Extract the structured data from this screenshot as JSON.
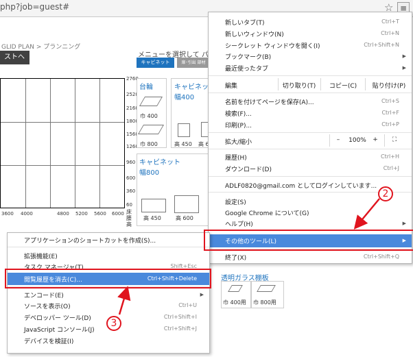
{
  "browser": {
    "url": "php?job=guest#",
    "star_icon": "star-icon",
    "menu_icon": "hamburger-menu-icon"
  },
  "page": {
    "breadcrumb": "GLID PLAN > プランニング",
    "next_button": "ストへ ❯",
    "menu_hint": "メニューを選択して パーツ",
    "btn_cabinet": "キャビネット",
    "btn_drawer": "扉･引出 部材",
    "chart_y_ticks": [
      "2760",
      "2520",
      "2160",
      "1800",
      "1560",
      "1260",
      "960",
      "600",
      "360",
      "60"
    ],
    "chart_x_ticks": [
      "3600",
      "4000",
      "4800",
      "5200",
      "5600",
      "6000"
    ],
    "floor_label": "床腰高",
    "cards": {
      "dai": {
        "title": "台輪",
        "size1": "巾 400",
        "size2": "巾 800"
      },
      "cab_400": {
        "title": "キャビネッ",
        "subtitle": "幅400",
        "size1": "高 450",
        "size2": "高 6"
      },
      "cab_800": {
        "title": "キャビネット",
        "subtitle": "幅800",
        "size1": "高 450",
        "size2": "高 600"
      },
      "glass": {
        "title": "透明ガラス棚板",
        "size1": "巾 400用",
        "size2": "巾 800用"
      }
    }
  },
  "chrome_menu": {
    "new_tab": {
      "label": "新しいタブ(T)",
      "shortcut": "Ctrl+T"
    },
    "new_window": {
      "label": "新しいウィンドウ(N)",
      "shortcut": "Ctrl+N"
    },
    "incognito": {
      "label": "シークレット ウィンドウを開く(I)",
      "shortcut": "Ctrl+Shift+N"
    },
    "bookmarks": {
      "label": "ブックマーク(B)"
    },
    "recent_tabs": {
      "label": "最近使ったタブ"
    },
    "edit": {
      "label": "編集",
      "cut": "切り取り(T)",
      "copy": "コピー(C)",
      "paste": "貼り付け(P)"
    },
    "save_page": {
      "label": "名前を付けてページを保存(A)...",
      "shortcut": "Ctrl+S"
    },
    "find": {
      "label": "検索(F)...",
      "shortcut": "Ctrl+F"
    },
    "print": {
      "label": "印刷(P)...",
      "shortcut": "Ctrl+P"
    },
    "zoom": {
      "label": "拡大/縮小",
      "minus": "–",
      "value": "100%",
      "plus": "+",
      "fullscreen_icon": "fullscreen-icon"
    },
    "history": {
      "label": "履歴(H)",
      "shortcut": "Ctrl+H"
    },
    "downloads": {
      "label": "ダウンロード(D)",
      "shortcut": "Ctrl+J"
    },
    "signed_in": {
      "label": "ADLF0820@gmail.com としてログインしています..."
    },
    "settings": {
      "label": "設定(S)"
    },
    "about": {
      "label": "Google Chrome について(G)"
    },
    "help": {
      "label": "ヘルプ(H)"
    },
    "more_tools": {
      "label": "その他のツール(L)"
    },
    "exit": {
      "label": "終了(X)",
      "shortcut": "Ctrl+Shift+Q"
    }
  },
  "submenu": {
    "create_shortcut": {
      "label": "アプリケーションのショートカットを作成(S)..."
    },
    "extensions": {
      "label": "拡張機能(E)"
    },
    "task_manager": {
      "label": "タスク マネージャ(T)",
      "shortcut": "Shift+Esc"
    },
    "clear_browsing": {
      "label": "閲覧履歴を消去(C)...",
      "shortcut": "Ctrl+Shift+Delete"
    },
    "encoding": {
      "label": "エンコード(E)"
    },
    "view_source": {
      "label": "ソースを表示(O)",
      "shortcut": "Ctrl+U"
    },
    "dev_tools": {
      "label": "デベロッパー ツール(D)",
      "shortcut": "Ctrl+Shift+I"
    },
    "js_console": {
      "label": "JavaScript コンソール(J)",
      "shortcut": "Ctrl+Shift+J"
    },
    "inspect_devices": {
      "label": "デバイスを検証(I)"
    }
  },
  "annotations": {
    "step2": "2",
    "step3": "3",
    "color": "#e0141e"
  }
}
